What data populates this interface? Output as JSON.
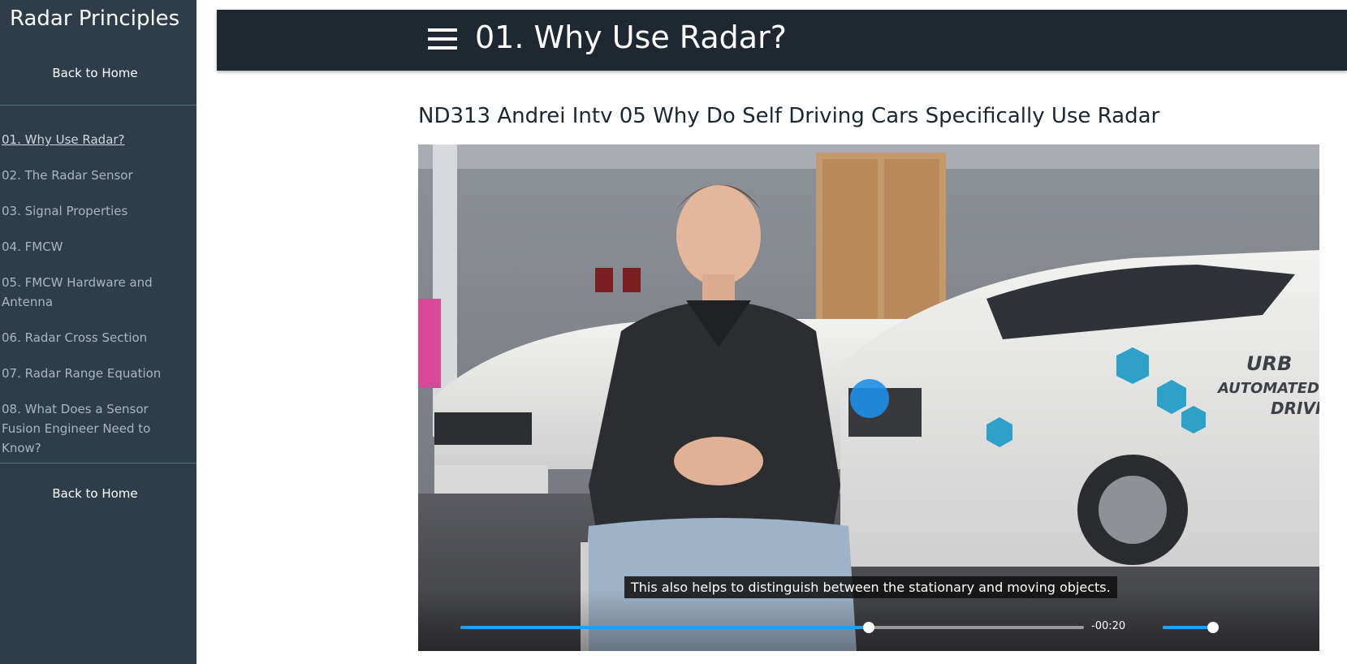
{
  "sidebar": {
    "title": "Radar Principles",
    "back_to_home_top": "Back to Home",
    "back_to_home_bottom": "Back to Home",
    "lessons": [
      {
        "label": "01. Why Use Radar?",
        "active": true
      },
      {
        "label": "02. The Radar Sensor",
        "active": false
      },
      {
        "label": "03. Signal Properties",
        "active": false
      },
      {
        "label": "04. FMCW",
        "active": false
      },
      {
        "label": "05. FMCW Hardware and Antenna",
        "active": false
      },
      {
        "label": "06. Radar Cross Section",
        "active": false
      },
      {
        "label": "07. Radar Range Equation",
        "active": false
      },
      {
        "label": "08. What Does a Sensor Fusion Engineer Need to Know?",
        "active": false
      }
    ]
  },
  "header": {
    "title": "01. Why Use Radar?",
    "menu_icon": "hamburger-menu-icon"
  },
  "video": {
    "title": "ND313 Andrei Intv 05 Why Do Self Driving Cars Specifically Use Radar",
    "caption": "This also helps to distinguish between the stationary and moving objects.",
    "time_remaining": "-00:20",
    "progress": 0.655,
    "volume": 0.94,
    "car_logo_text": "URB",
    "car_text_line2": "AUTOMATED",
    "car_text_line3": "DRIVI"
  },
  "colors": {
    "sidebar_bg": "#2e3d49",
    "header_bg": "#1f2830",
    "accent": "#1ea1f2",
    "cursor_dot": "#1f8fe5"
  }
}
